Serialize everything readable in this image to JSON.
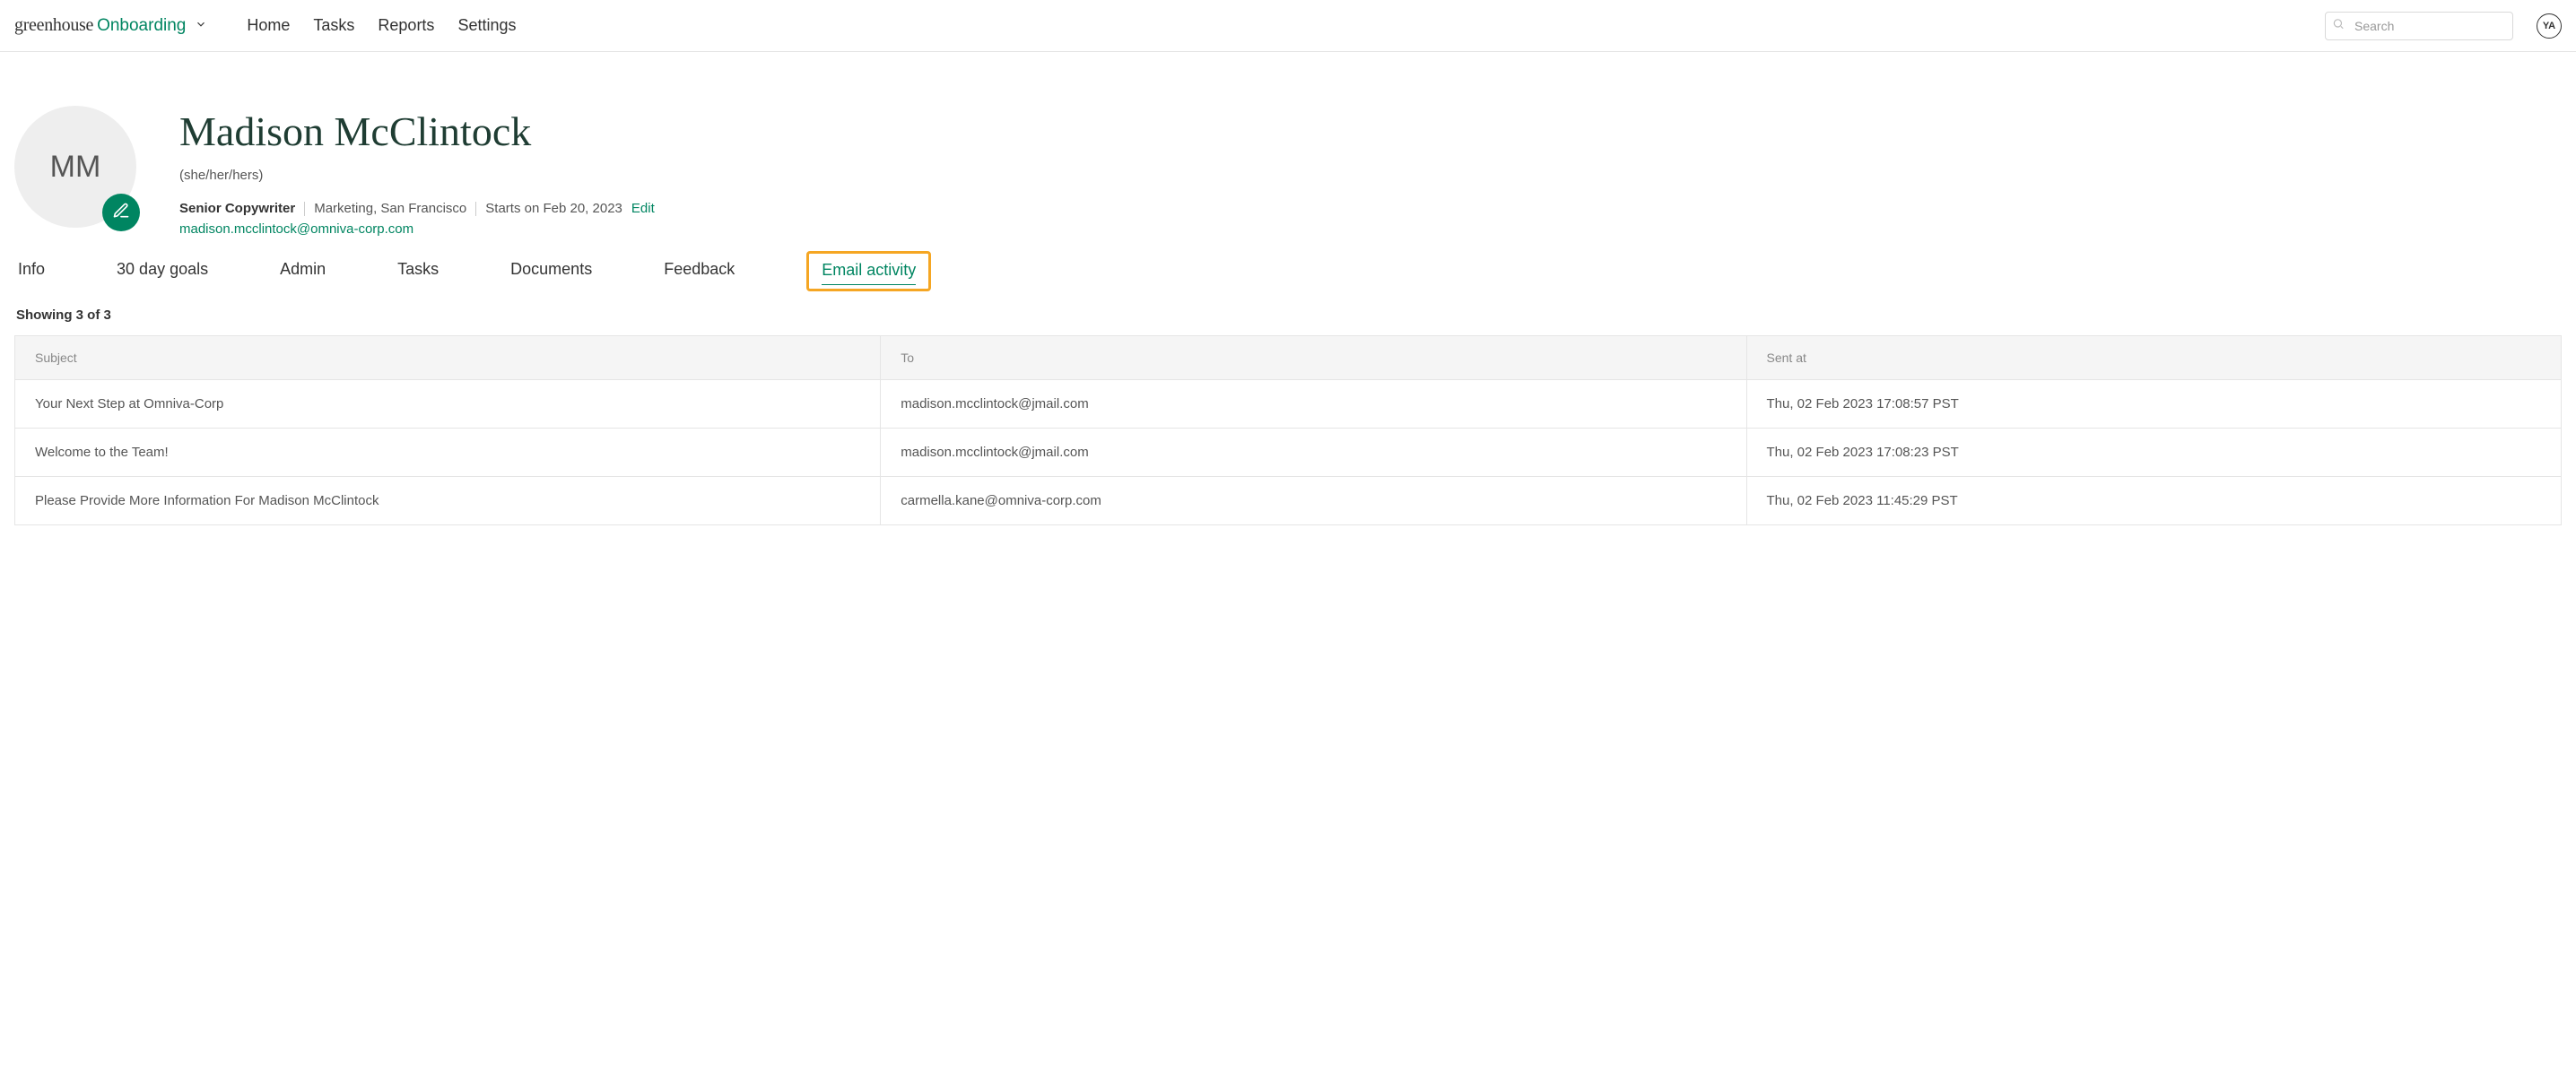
{
  "brand": {
    "main": "greenhouse",
    "sub": "Onboarding"
  },
  "nav": [
    "Home",
    "Tasks",
    "Reports",
    "Settings"
  ],
  "search": {
    "placeholder": "Search"
  },
  "user_badge": "YA",
  "profile": {
    "initials": "MM",
    "name": "Madison McClintock",
    "pronouns": "(she/her/hers)",
    "title": "Senior Copywriter",
    "dept_loc": "Marketing, San Francisco",
    "start_text": "Starts on Feb 20, 2023",
    "edit_label": "Edit",
    "email": "madison.mcclintock@omniva-corp.com"
  },
  "tabs": {
    "items": [
      "Info",
      "30 day goals",
      "Admin",
      "Tasks",
      "Documents",
      "Feedback",
      "Email activity"
    ],
    "active_index": 6
  },
  "results_label": "Showing 3 of 3",
  "columns": {
    "subject": "Subject",
    "to": "To",
    "sent_at": "Sent at"
  },
  "rows": [
    {
      "subject": "Your Next Step at Omniva-Corp",
      "to": "madison.mcclintock@jmail.com",
      "sent_at": "Thu, 02 Feb 2023 17:08:57 PST"
    },
    {
      "subject": "Welcome to the Team!",
      "to": "madison.mcclintock@jmail.com",
      "sent_at": "Thu, 02 Feb 2023 17:08:23 PST"
    },
    {
      "subject": "Please Provide More Information For Madison McClintock",
      "to": "carmella.kane@omniva-corp.com",
      "sent_at": "Thu, 02 Feb 2023 11:45:29 PST"
    }
  ]
}
